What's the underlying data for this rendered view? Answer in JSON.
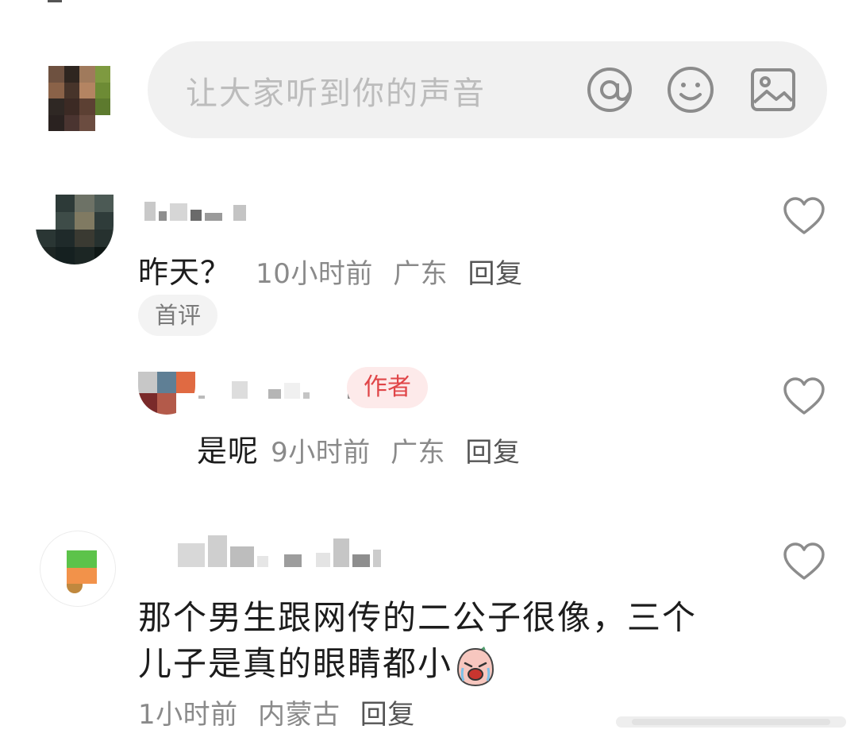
{
  "composer": {
    "placeholder": "让大家听到你的声音",
    "icons": [
      "at-icon",
      "emoji-icon",
      "image-icon"
    ]
  },
  "comments": [
    {
      "text": "昨天？",
      "time": "10小时前",
      "location": "广东",
      "reply_label": "回复",
      "badge": "首评",
      "liked": false
    },
    {
      "text": "是呢",
      "time": "9小时前",
      "location": "广东",
      "reply_label": "回复",
      "badge": "作者",
      "liked": false
    },
    {
      "text_line1": "那个男生跟网传的二公子很像，三个",
      "text_line2": "儿子是真的眼睛都小",
      "emoji": "crying-face-sticker",
      "time": "1小时前",
      "location": "内蒙古",
      "reply_label": "回复",
      "liked": false
    }
  ],
  "colors": {
    "input_bg": "#f1f1f1",
    "placeholder": "#bcbcbc",
    "icon_gray": "#8c8c8c",
    "meta_gray": "#8a8a8a",
    "author_tag_bg": "#fdeaea",
    "author_tag_text": "#e04548"
  }
}
